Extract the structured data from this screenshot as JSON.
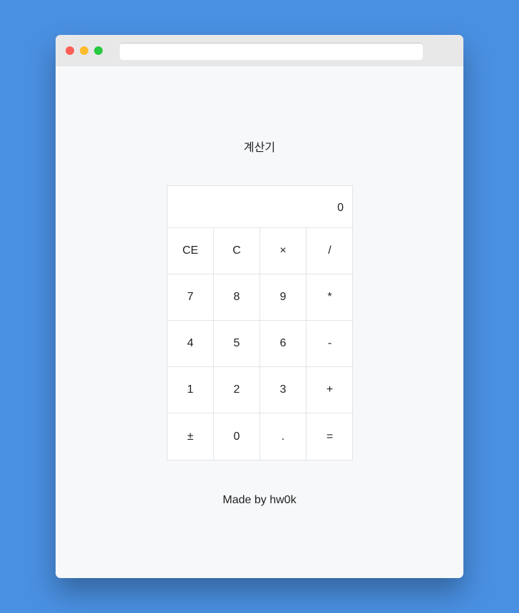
{
  "window": {
    "traffic_lights": {
      "close": "#ff5f57",
      "minimize": "#febc2e",
      "maximize": "#28c840"
    },
    "url": ""
  },
  "title": "계산기",
  "display": "0",
  "keys": [
    "CE",
    "C",
    "×",
    "/",
    "7",
    "8",
    "9",
    "*",
    "4",
    "5",
    "6",
    "-",
    "1",
    "2",
    "3",
    "+",
    "±",
    "0",
    ".",
    "="
  ],
  "footer": "Made by hw0k"
}
